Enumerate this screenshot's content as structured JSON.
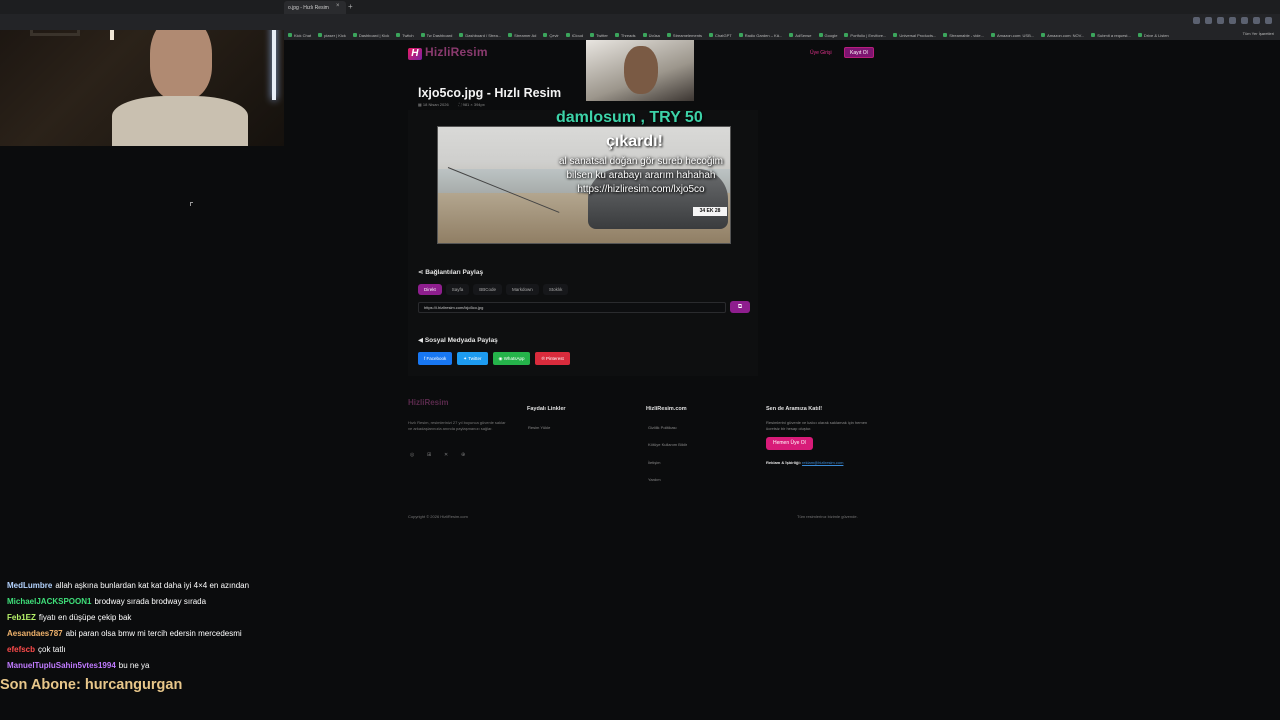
{
  "browser": {
    "tab_title": "o.jpg - Hızlı Resim",
    "tab_close": "×",
    "tab_new": "+",
    "bookmarks": [
      "Kick Chat",
      "piaser | Kick",
      "Dashboard | Kick",
      "Twitch",
      "Tw Dashboard",
      "Dashboard / Strea...",
      "Streamer Ad",
      "Çevir",
      "iCloud",
      "Twitter",
      "Threads",
      "Ücüsa",
      "Streamelements",
      "ChatGPT",
      "Radio Garden – Kä...",
      "AdSense",
      "Google",
      "Portfolio | Envifore...",
      "Universal Products...",
      "Streamable - vide...",
      "Amazon.com: USB...",
      "Amazon.com: NOV...",
      "Submit a request...",
      "Drive & Listen"
    ],
    "bookmarks_right": "Tüm Yer İşaretleri"
  },
  "site": {
    "logo_mark": "H",
    "logo_text": "HizliResim",
    "nav_link": "Üye Girişi",
    "nav_button": "Kayıt Ol"
  },
  "main": {
    "title": "lxjo5co.jpg - Hızlı Resim",
    "date": "18 Nisan 2026",
    "dimensions": "981 × 394px",
    "plate": "34 EK 28",
    "share_heading": "Bağlantıları Paylaş",
    "tabs": [
      "Direkt",
      "Sayfa",
      "BBCode",
      "Markdown",
      "Stoklık"
    ],
    "url_value": "https://i.hizliresim.com/lxjo5co.jpg",
    "copy_icon": "⧉",
    "social_heading": "Sosyal Medyada Paylaş",
    "social_buttons": [
      "Facebook",
      "Twitter",
      "WhatsApp",
      "Pinterest"
    ]
  },
  "footer": {
    "logo": "HizliResim",
    "desc": "Hızlı Resim, resimlerinizi 27 yıl boyunca güvenle saklar ve arkadaşlarınızla anında paylaşmanızı sağlar.",
    "icons": [
      "◎",
      "⊞",
      "✕",
      "⊕"
    ],
    "col1_heading": "Faydalı Linkler",
    "col1_links": [
      "Resim Yükle"
    ],
    "col2_heading": "HizliResim.com",
    "col2_links": [
      "Gizlilik Politikası",
      "Kötüye Kullanım Bildir",
      "İletişim",
      "Yardım"
    ],
    "col3_heading": "Sen de Aramıza Katıl!",
    "col3_desc": "Resimlerini güvenle ve kalıcı olarak saklamak için hemen ücretsiz bir hesap oluştur.",
    "join_button": "Hemen Üye Ol",
    "contact_label": "Reklam & İşbirliği:",
    "contact_email": "reklam@hizliresim.com",
    "copyright": "Copyright © 2026 HizliResim.com",
    "rights": "Tüm resimlerinız bizimle güvende."
  },
  "overlay": {
    "donation_title": "damlosum , TRY 50",
    "donation_sub": "çıkardı!",
    "donation_msg_1": "al sanatsal doğan gör sureb hecoğim",
    "donation_msg_2": "bilsen ku arabayı ararım hahahah",
    "donation_msg_3": "https://hizliresim.com/lxjo5co"
  },
  "chat": [
    {
      "user": "MedLumbre",
      "color": "#b4d4ff",
      "text": "allah aşkına bunlardan kat kat daha iyi 4×4 en azından"
    },
    {
      "user": "MichaelJACKSPOON1",
      "color": "#3fe07a",
      "text": "brodway sırada brodway sırada"
    },
    {
      "user": "Feb1EZ",
      "color": "#b8f36a",
      "text": "fiyatı en düşüpe çekip bak"
    },
    {
      "user": "Aesandaes787",
      "color": "#f0b36c",
      "text": "abi paran olsa bmw mi tercih edersin mercedesmi"
    },
    {
      "user": "efefscb",
      "color": "#ff4b4b",
      "text": "çok tatlı"
    },
    {
      "user": "ManuelTupluSahin5vtes1994",
      "color": "#c07bff",
      "text": "bu ne ya"
    }
  ],
  "son_abone": "Son Abone: hurcangurgan"
}
